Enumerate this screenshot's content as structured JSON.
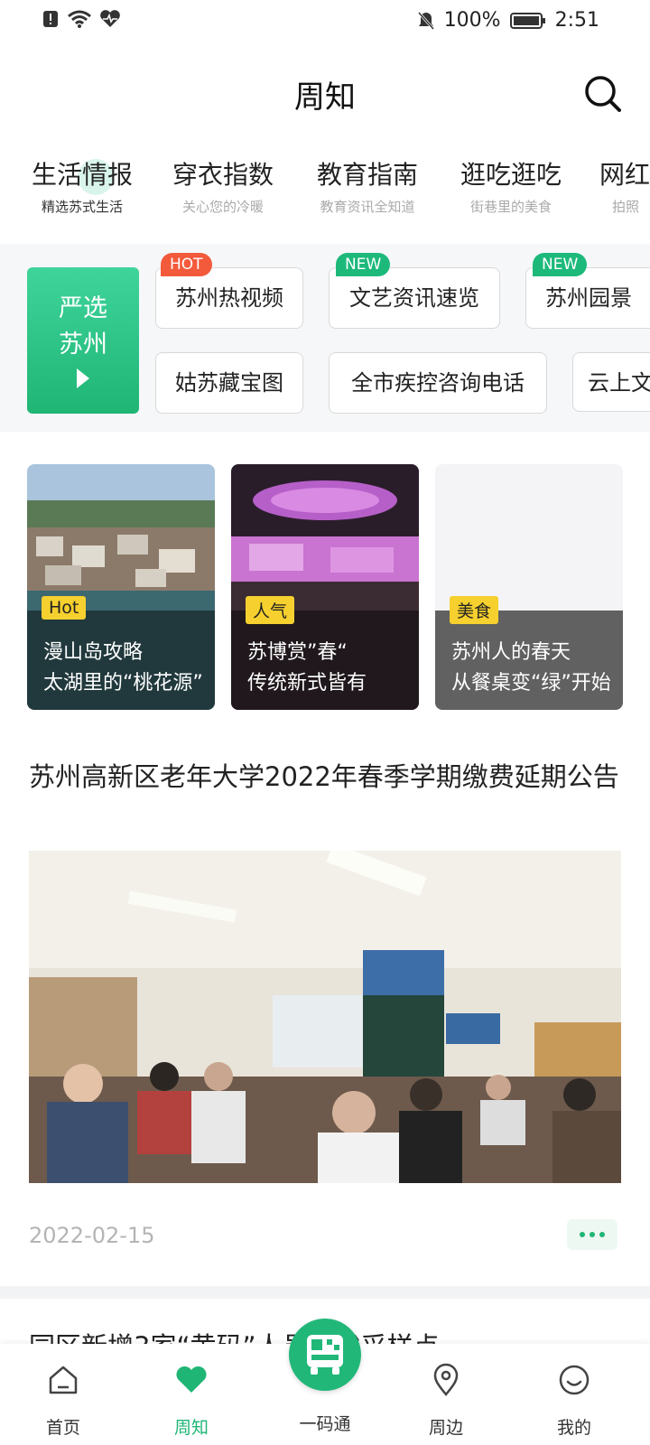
{
  "status_bar": {
    "battery": "100%",
    "time": "2:51",
    "icons": [
      "alert-icon",
      "wifi-icon",
      "heart-pulse-icon",
      "mute-bell-icon",
      "battery-icon"
    ]
  },
  "header": {
    "title": "周知",
    "search_icon": "search-icon"
  },
  "categories": [
    {
      "name": "生活情报",
      "sub": "精选苏式生活",
      "active": true
    },
    {
      "name": "穿衣指数",
      "sub": "关心您的冷暖"
    },
    {
      "name": "教育指南",
      "sub": "教育资讯全知道"
    },
    {
      "name": "逛吃逛吃",
      "sub": "街巷里的美食"
    },
    {
      "name": "网红",
      "sub": "拍照"
    }
  ],
  "yanxuan": {
    "line1": "严选",
    "line2": "苏州"
  },
  "tags_row1": [
    {
      "label": "苏州热视频",
      "badge": "HOT"
    },
    {
      "label": "文艺资讯速览",
      "badge": "NEW"
    },
    {
      "label": "苏州园景",
      "badge": "NEW"
    }
  ],
  "tags_row2": [
    {
      "label": "姑苏藏宝图"
    },
    {
      "label": "全市疾控咨询电话"
    },
    {
      "label": "云上文"
    }
  ],
  "feature_cards": [
    {
      "tag": "Hot",
      "line1": "漫山岛攻略",
      "line2": "太湖里的“桃花源”"
    },
    {
      "tag": "人气",
      "line1": "苏博赏”春“",
      "line2": "传统新式皆有"
    },
    {
      "tag": "美食",
      "line1": "苏州人的春天",
      "line2": "从餐桌变“绿”开始"
    }
  ],
  "article": {
    "title": "苏州高新区老年大学2022年春季学期缴费延期公告",
    "date": "2022-02-15"
  },
  "next_article": {
    "title": "园区新增3家“黄码”人员核酸采样点"
  },
  "bottom_nav": [
    {
      "label": "首页",
      "icon": "home-icon"
    },
    {
      "label": "周知",
      "icon": "heart-icon",
      "active": true
    },
    {
      "label": "一码通",
      "icon": "qr-bus-icon"
    },
    {
      "label": "周边",
      "icon": "location-pin-icon"
    },
    {
      "label": "我的",
      "icon": "smiley-icon"
    }
  ],
  "colors": {
    "accent": "#1fb575",
    "hot_badge": "#f25a3b",
    "card_tag": "#f6d02e"
  }
}
